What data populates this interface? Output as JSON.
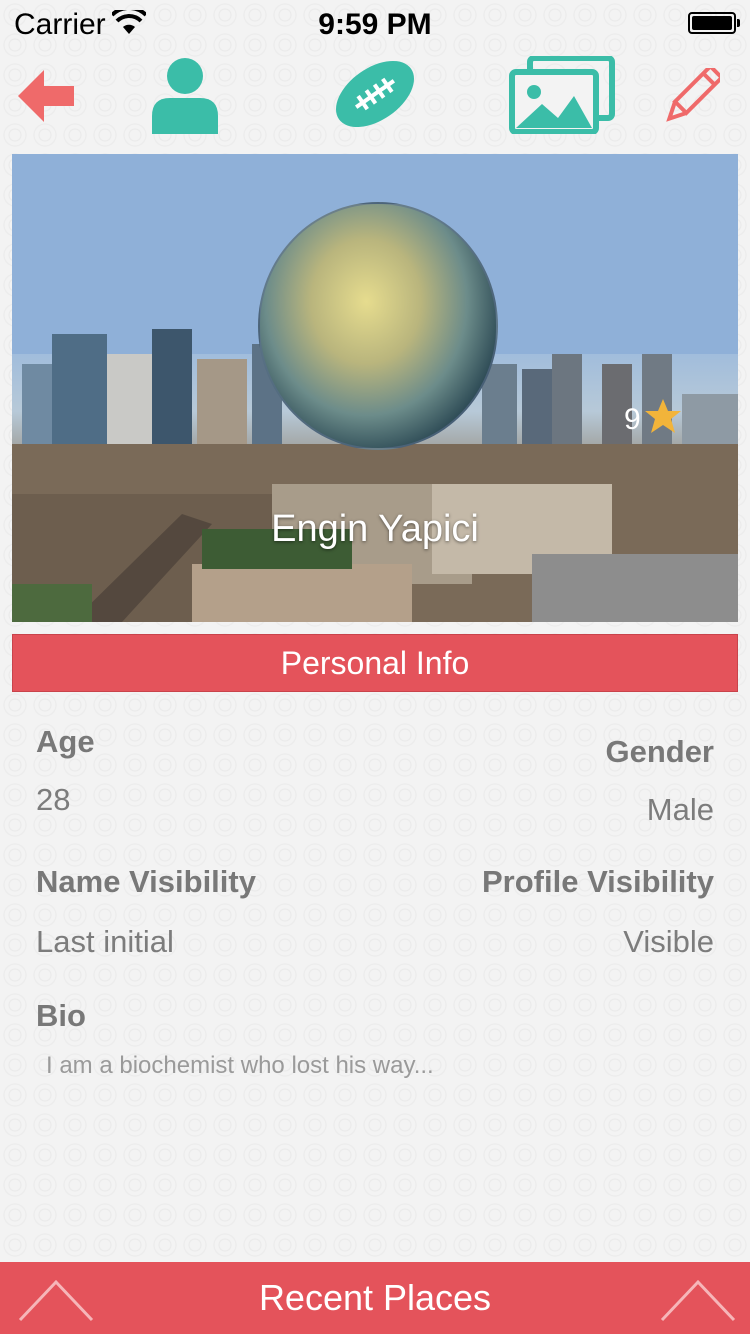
{
  "status_bar": {
    "carrier": "Carrier",
    "time": "9:59 PM"
  },
  "toolbar": {
    "icons": [
      "back-arrow-icon",
      "person-icon",
      "football-icon",
      "gallery-icon",
      "edit-pencil-icon"
    ],
    "colors": {
      "accent_teal": "#3bbda8",
      "accent_red": "#e4535b"
    }
  },
  "profile": {
    "name": "Engin Yapici",
    "rating": "9"
  },
  "section": {
    "title": "Personal Info"
  },
  "info": {
    "age_label": "Age",
    "age_value": "28",
    "gender_label": "Gender",
    "gender_value": "Male",
    "name_visibility_label": "Name Visibility",
    "name_visibility_value": "Last initial",
    "profile_visibility_label": "Profile Visibility",
    "profile_visibility_value": "Visible",
    "bio_label": "Bio",
    "bio_value": "I am a  biochemist who lost his way..."
  },
  "footer": {
    "title": "Recent Places"
  }
}
